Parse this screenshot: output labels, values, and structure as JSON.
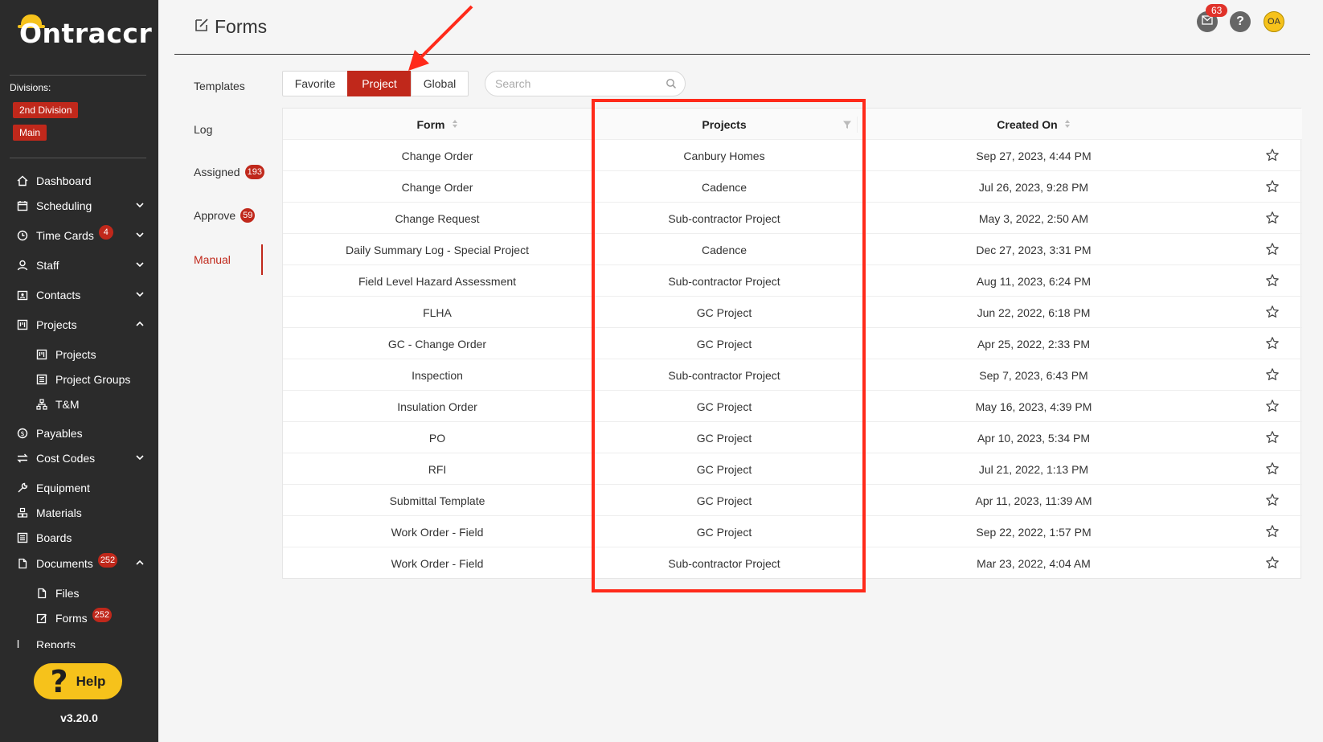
{
  "sidebar": {
    "logo": "Ontraccr",
    "divisions_label": "Divisions:",
    "divisions": [
      "2nd Division",
      "Main"
    ],
    "nav": {
      "dashboard": "Dashboard",
      "scheduling": "Scheduling",
      "time_cards": "Time Cards",
      "time_cards_badge": "4",
      "staff": "Staff",
      "contacts": "Contacts",
      "projects": "Projects",
      "projects_sub": "Projects",
      "project_groups": "Project Groups",
      "tm": "T&M",
      "payables": "Payables",
      "cost_codes": "Cost Codes",
      "equipment": "Equipment",
      "materials": "Materials",
      "boards": "Boards",
      "documents": "Documents",
      "documents_badge": "252",
      "files": "Files",
      "forms": "Forms",
      "forms_badge": "252",
      "reports": "Reports"
    },
    "help_label": "Help",
    "version": "v3.20.0"
  },
  "header": {
    "title": "Forms",
    "mail_badge": "63",
    "help_glyph": "?",
    "avatar_initials": "OA"
  },
  "side_tabs": {
    "templates": "Templates",
    "log": "Log",
    "assigned": "Assigned",
    "assigned_badge": "193",
    "approve": "Approve",
    "approve_badge": "59",
    "manual": "Manual"
  },
  "filter_tabs": {
    "favorite": "Favorite",
    "project": "Project",
    "global": "Global"
  },
  "search": {
    "placeholder": "Search"
  },
  "table": {
    "columns": {
      "form": "Form",
      "projects": "Projects",
      "created_on": "Created On"
    },
    "rows": [
      {
        "form": "Change Order",
        "project": "Canbury Homes",
        "created": "Sep 27, 2023, 4:44 PM"
      },
      {
        "form": "Change Order",
        "project": "Cadence",
        "created": "Jul 26, 2023, 9:28 PM"
      },
      {
        "form": "Change Request",
        "project": "Sub-contractor Project",
        "created": "May 3, 2022, 2:50 AM"
      },
      {
        "form": "Daily Summary Log - Special Project",
        "project": "Cadence",
        "created": "Dec 27, 2023, 3:31 PM"
      },
      {
        "form": "Field Level Hazard Assessment",
        "project": "Sub-contractor Project",
        "created": "Aug 11, 2023, 6:24 PM"
      },
      {
        "form": "FLHA",
        "project": "GC Project",
        "created": "Jun 22, 2022, 6:18 PM"
      },
      {
        "form": "GC - Change Order",
        "project": "GC Project",
        "created": "Apr 25, 2022, 2:33 PM"
      },
      {
        "form": "Inspection",
        "project": "Sub-contractor Project",
        "created": "Sep 7, 2023, 6:43 PM"
      },
      {
        "form": "Insulation Order",
        "project": "GC Project",
        "created": "May 16, 2023, 4:39 PM"
      },
      {
        "form": "PO",
        "project": "GC Project",
        "created": "Apr 10, 2023, 5:34 PM"
      },
      {
        "form": "RFI",
        "project": "GC Project",
        "created": "Jul 21, 2022, 1:13 PM"
      },
      {
        "form": "Submittal Template",
        "project": "GC Project",
        "created": "Apr 11, 2023, 11:39 AM"
      },
      {
        "form": "Work Order - Field",
        "project": "GC Project",
        "created": "Sep 22, 2022, 1:57 PM"
      },
      {
        "form": "Work Order - Field",
        "project": "Sub-contractor Project",
        "created": "Mar 23, 2022, 4:04 AM"
      }
    ]
  },
  "colors": {
    "accent": "#c0281b",
    "sidebar_bg": "#2b2b2b",
    "help_yellow": "#f6c21b",
    "annotation_red": "#ff2a1a"
  }
}
